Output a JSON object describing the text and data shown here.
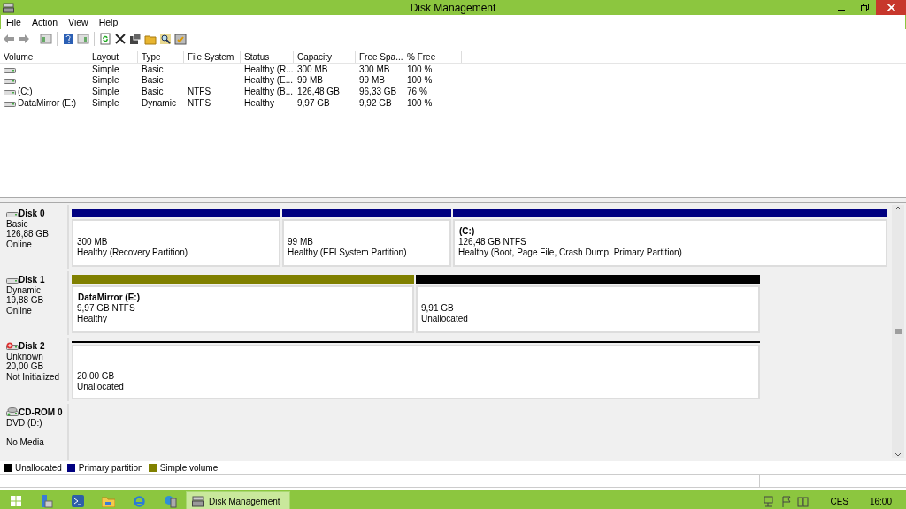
{
  "window": {
    "title": "Disk Management"
  },
  "menu": [
    "File",
    "Action",
    "View",
    "Help"
  ],
  "volumes": {
    "columns": [
      "Volume",
      "Layout",
      "Type",
      "File System",
      "Status",
      "Capacity",
      "Free Spa...",
      "% Free"
    ],
    "rows": [
      {
        "cells": [
          "",
          "Simple",
          "Basic",
          "",
          "Healthy (R...",
          "300 MB",
          "300 MB",
          "100 %"
        ]
      },
      {
        "cells": [
          "",
          "Simple",
          "Basic",
          "",
          "Healthy (E...",
          "99 MB",
          "99 MB",
          "100 %"
        ]
      },
      {
        "cells": [
          "(C:)",
          "Simple",
          "Basic",
          "NTFS",
          "Healthy (B...",
          "126,48 GB",
          "96,33 GB",
          "76 %"
        ]
      },
      {
        "cells": [
          "DataMirror (E:)",
          "Simple",
          "Dynamic",
          "NTFS",
          "Healthy",
          "9,97 GB",
          "9,92 GB",
          "100 %"
        ]
      }
    ]
  },
  "disks": [
    {
      "kind": "disk",
      "name": "Disk 0",
      "lines": [
        "Basic",
        "126,88 GB",
        "Online"
      ],
      "partitions": [
        {
          "color": "#000080",
          "lines": [
            "300 MB",
            "Healthy (Recovery Partition)"
          ]
        },
        {
          "color": "#000080",
          "lines": [
            "99 MB",
            "Healthy (EFI System Partition)"
          ]
        },
        {
          "color": "#000080",
          "name": "(C:)",
          "lines": [
            "126,48 GB NTFS",
            "Healthy (Boot, Page File, Crash Dump, Primary Partition)"
          ]
        }
      ]
    },
    {
      "kind": "disk",
      "name": "Disk 1",
      "lines": [
        "Dynamic",
        "19,88 GB",
        "Online"
      ],
      "partitions": [
        {
          "color": "#808000",
          "name": "DataMirror  (E:)",
          "lines": [
            "9,97 GB NTFS",
            "Healthy"
          ]
        },
        {
          "color": "#000000",
          "lines": [
            "9,91 GB",
            "Unallocated"
          ]
        }
      ]
    },
    {
      "kind": "disk-error",
      "name": "Disk 2",
      "lines": [
        "Unknown",
        "20,00 GB",
        "Not Initialized"
      ],
      "partitions": [
        {
          "color": "#000000",
          "lines": [
            "20,00 GB",
            "Unallocated"
          ]
        }
      ]
    },
    {
      "kind": "cdrom",
      "name": "CD-ROM 0",
      "lines": [
        "DVD (D:)",
        "No Media"
      ]
    }
  ],
  "legend": [
    {
      "label": "Unallocated",
      "color": "#000000"
    },
    {
      "label": "Primary partition",
      "color": "#000080"
    },
    {
      "label": "Simple volume",
      "color": "#808000"
    }
  ],
  "taskbar": {
    "apps": [
      {
        "label": "Disk Management",
        "selected": true
      }
    ],
    "tray": [
      "CES",
      "16:00"
    ]
  }
}
